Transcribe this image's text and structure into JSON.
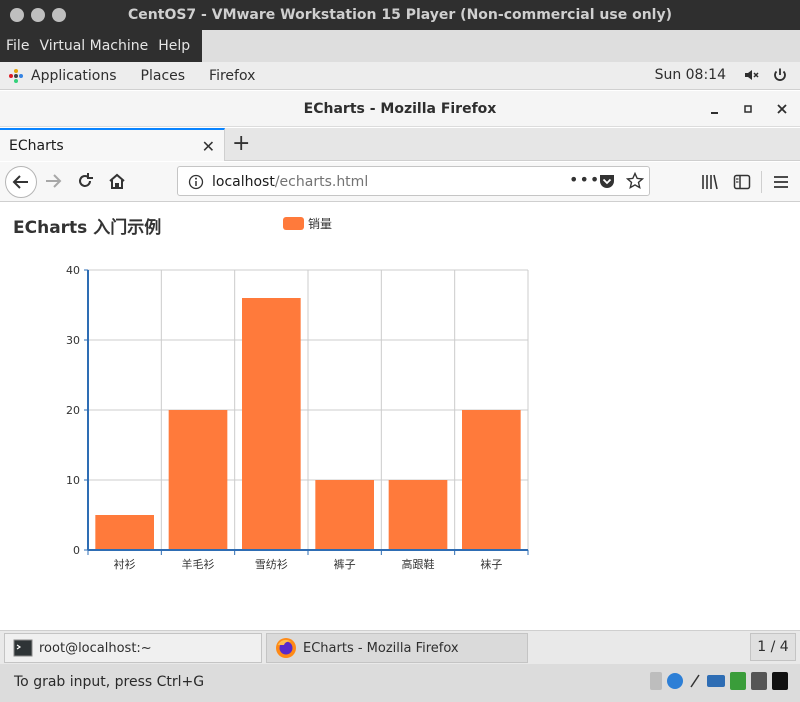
{
  "vmware": {
    "title": "CentOS7 - VMware Workstation 15 Player (Non-commercial use only)",
    "menu": [
      "File",
      "Virtual Machine",
      "Help"
    ],
    "status_text": "To grab input, press Ctrl+G"
  },
  "gnome": {
    "applications": "Applications",
    "places": "Places",
    "firefox": "Firefox",
    "time": "Sun 08:14"
  },
  "firefox": {
    "window_title": "ECharts - Mozilla Firefox",
    "tab_label": "ECharts",
    "url_host": "localhost",
    "url_path": "/echarts.html"
  },
  "page": {
    "title": "ECharts 入门示例"
  },
  "chart_data": {
    "type": "bar",
    "title": "ECharts 入门示例",
    "categories": [
      "衬衫",
      "羊毛衫",
      "雪纺衫",
      "裤子",
      "高跟鞋",
      "袜子"
    ],
    "series": [
      {
        "name": "销量",
        "values": [
          5,
          20,
          36,
          10,
          10,
          20
        ]
      }
    ],
    "ylim": [
      0,
      40
    ],
    "yticks": [
      "0",
      "10",
      "20",
      "30",
      "40"
    ],
    "grid": true,
    "legend": "top-center",
    "color": "#ff7a3b"
  },
  "taskbar": {
    "terminal": "root@localhost:~",
    "firefox": "ECharts - Mozilla Firefox",
    "workspace": "1 / 4"
  }
}
